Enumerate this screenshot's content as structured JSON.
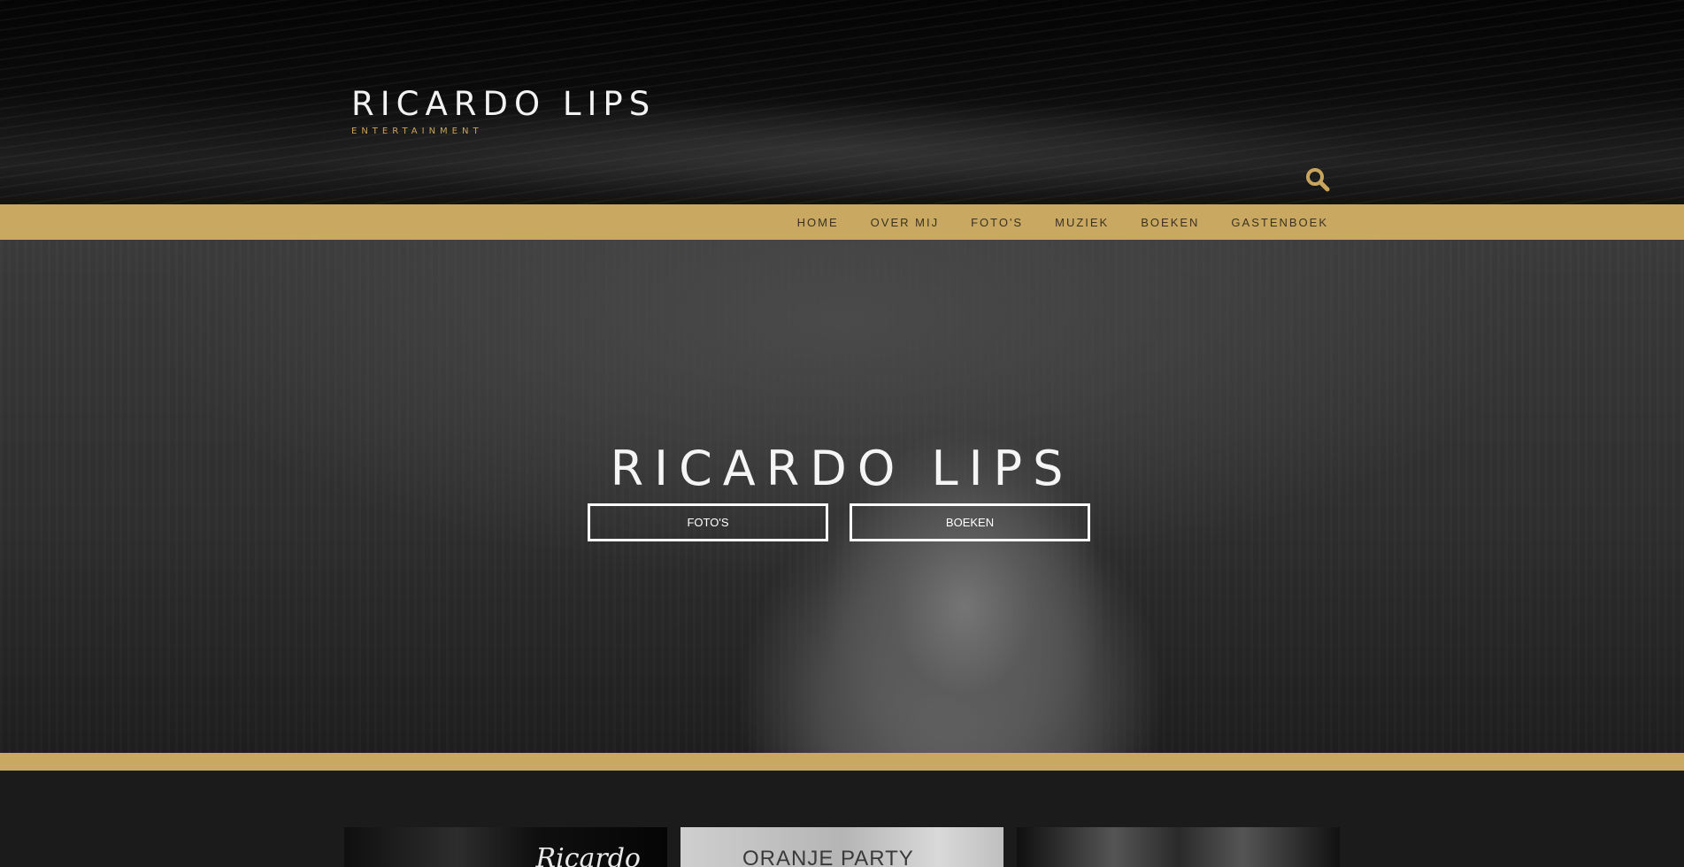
{
  "header": {
    "brand_name": "RICARDO LIPS",
    "brand_subtitle": "ENTERTAINMENT",
    "search_icon": "search-icon"
  },
  "nav": {
    "items": [
      {
        "label": "HOME"
      },
      {
        "label": "OVER MIJ"
      },
      {
        "label": "FOTO'S"
      },
      {
        "label": "MUZIEK"
      },
      {
        "label": "BOEKEN"
      },
      {
        "label": "GASTENBOEK"
      }
    ]
  },
  "hero": {
    "title": "RICARDO LIPS",
    "buttons": [
      {
        "label": "FOTO'S"
      },
      {
        "label": "BOEKEN"
      }
    ]
  },
  "thumbnails": [
    {
      "caption": "Ricardo"
    },
    {
      "caption": "ORANJE PARTY"
    },
    {
      "caption": ""
    }
  ],
  "colors": {
    "accent_gold": "#c9a962",
    "brand_sub_gold": "#c9a45c",
    "dark_bg": "#1b1b1b"
  }
}
